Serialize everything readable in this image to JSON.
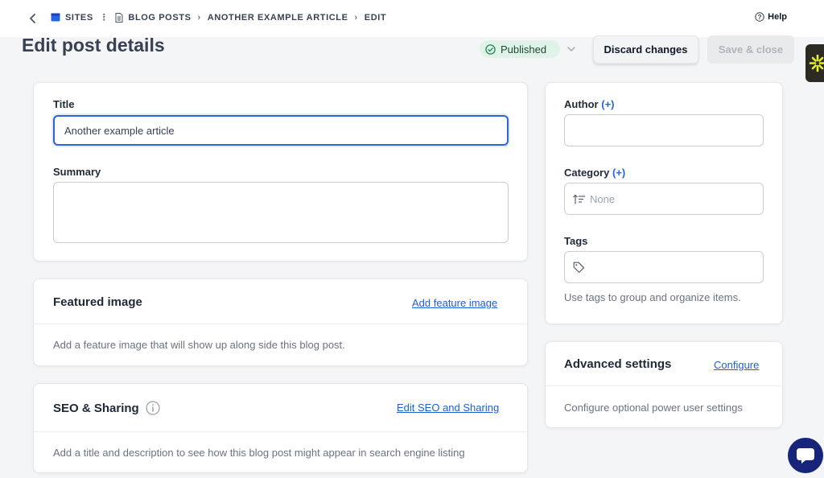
{
  "breadcrumb": {
    "items": [
      {
        "label": "SITES",
        "icon": "sites-icon"
      },
      {
        "label": "BLOG POSTS",
        "icon": "document-icon"
      },
      {
        "label": "ANOTHER EXAMPLE ARTICLE"
      },
      {
        "label": "EDIT"
      }
    ],
    "help_label": "Help"
  },
  "header": {
    "title": "Edit post details",
    "status": "Published",
    "discard_label": "Discard changes",
    "save_label": "Save & close"
  },
  "main": {
    "title_label": "Title",
    "title_value": "Another example article",
    "summary_label": "Summary",
    "summary_value": "",
    "featured": {
      "title": "Featured image",
      "action": "Add feature image",
      "description": "Add a feature image that will show up along side this blog post."
    },
    "seo": {
      "title": "SEO & Sharing",
      "action": "Edit SEO and Sharing",
      "description": "Add a title and description to see how this blog post might appear in search engine listing"
    }
  },
  "sidebar": {
    "author_label": "Author",
    "category_label": "Category",
    "plus": "(+)",
    "category_placeholder": "None",
    "tags_label": "Tags",
    "tags_hint": "Use tags to group and organize items.",
    "advanced": {
      "title": "Advanced settings",
      "action": "Configure",
      "description": "Configure optional power user settings"
    }
  },
  "colors": {
    "accent": "#2f64d6",
    "status_bg": "#dff3e8",
    "status_icon": "#1e8a50",
    "chat": "#16257a"
  }
}
